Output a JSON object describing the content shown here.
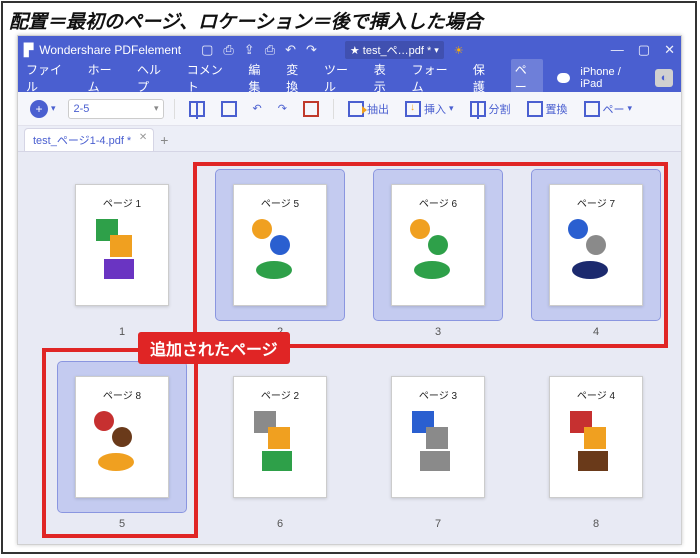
{
  "caption": "配置＝最初のページ、ロケーション＝後で挿入した場合",
  "titlebar": {
    "app_name": "Wondershare PDFelement",
    "file_dropdown": "test_ペ…pdf *",
    "star": "★"
  },
  "window_controls": {
    "min": "—",
    "max": "▢",
    "close": "✕"
  },
  "menu": {
    "file": "ファイル",
    "home": "ホーム",
    "help": "ヘルプ",
    "comment": "コメント",
    "edit": "編集",
    "convert": "変換",
    "tool": "ツール",
    "view": "表示",
    "form": "フォーム",
    "protect": "保護",
    "page": "ペー",
    "iphone": "iPhone / iPad"
  },
  "toolbar": {
    "range_value": "2-5",
    "extract": "抽出",
    "insert": "挿入",
    "split": "分割",
    "replace": "置換",
    "page_btn": "ペー"
  },
  "tabs": {
    "doc1": "test_ページ1-4.pdf *"
  },
  "thumbs": [
    {
      "index": 1,
      "label": "ページ 1",
      "selected": false,
      "colors": [
        "#2ea049",
        "#f0a020",
        "#6a34c2"
      ],
      "style": "A"
    },
    {
      "index": 2,
      "label": "ページ 5",
      "selected": true,
      "colors": [
        "#f0a020",
        "#2a5fd0",
        "#2ea049"
      ],
      "style": "B"
    },
    {
      "index": 3,
      "label": "ページ 6",
      "selected": true,
      "colors": [
        "#f0a020",
        "#2ea049",
        "#2ea049"
      ],
      "style": "B"
    },
    {
      "index": 4,
      "label": "ページ 7",
      "selected": true,
      "colors": [
        "#2a5fd0",
        "#8a8a8a",
        "#1c2a6e"
      ],
      "style": "B"
    },
    {
      "index": 5,
      "label": "ページ 8",
      "selected": true,
      "colors": [
        "#c63030",
        "#6a3a1a",
        "#f0a020"
      ],
      "style": "B"
    },
    {
      "index": 6,
      "label": "ページ 2",
      "selected": false,
      "colors": [
        "#8a8a8a",
        "#f0a020",
        "#2ea049"
      ],
      "style": "A"
    },
    {
      "index": 7,
      "label": "ページ 3",
      "selected": false,
      "colors": [
        "#2a5fd0",
        "#8a8a8a",
        "#8a8a8a"
      ],
      "style": "A"
    },
    {
      "index": 8,
      "label": "ページ 4",
      "selected": false,
      "colors": [
        "#c63030",
        "#f0a020",
        "#6a3a1a"
      ],
      "style": "A"
    }
  ],
  "annotation": {
    "added_pages": "追加されたページ"
  }
}
